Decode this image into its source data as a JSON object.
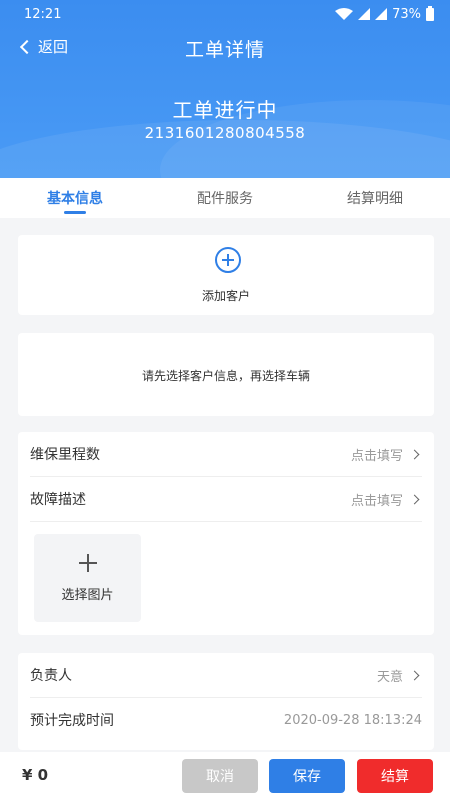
{
  "status_bar": {
    "time": "12:21",
    "battery": "73%"
  },
  "nav": {
    "back_label": "返回",
    "title": "工单详情"
  },
  "order": {
    "status": "工单进行中",
    "number": "2131601280804558"
  },
  "tabs": [
    {
      "label": "基本信息",
      "active": true
    },
    {
      "label": "配件服务",
      "active": false
    },
    {
      "label": "结算明细",
      "active": false
    }
  ],
  "customer": {
    "add_label": "添加客户",
    "hint": "请先选择客户信息，再选择车辆"
  },
  "form": {
    "mileage": {
      "label": "维保里程数",
      "value": "点击填写"
    },
    "fault": {
      "label": "故障描述",
      "value": "点击填写"
    },
    "picture_label": "选择图片"
  },
  "people": {
    "owner": {
      "label": "负责人",
      "value": "天意"
    },
    "eta": {
      "label": "预计完成时间",
      "value": "2020-09-28 18:13:24"
    }
  },
  "footer": {
    "price": "¥ 0",
    "cancel": "取消",
    "save": "保存",
    "settle": "结算"
  },
  "colors": {
    "primary": "#2f7fe6",
    "danger": "#f02c2c",
    "disabled": "#c8c8c8"
  }
}
